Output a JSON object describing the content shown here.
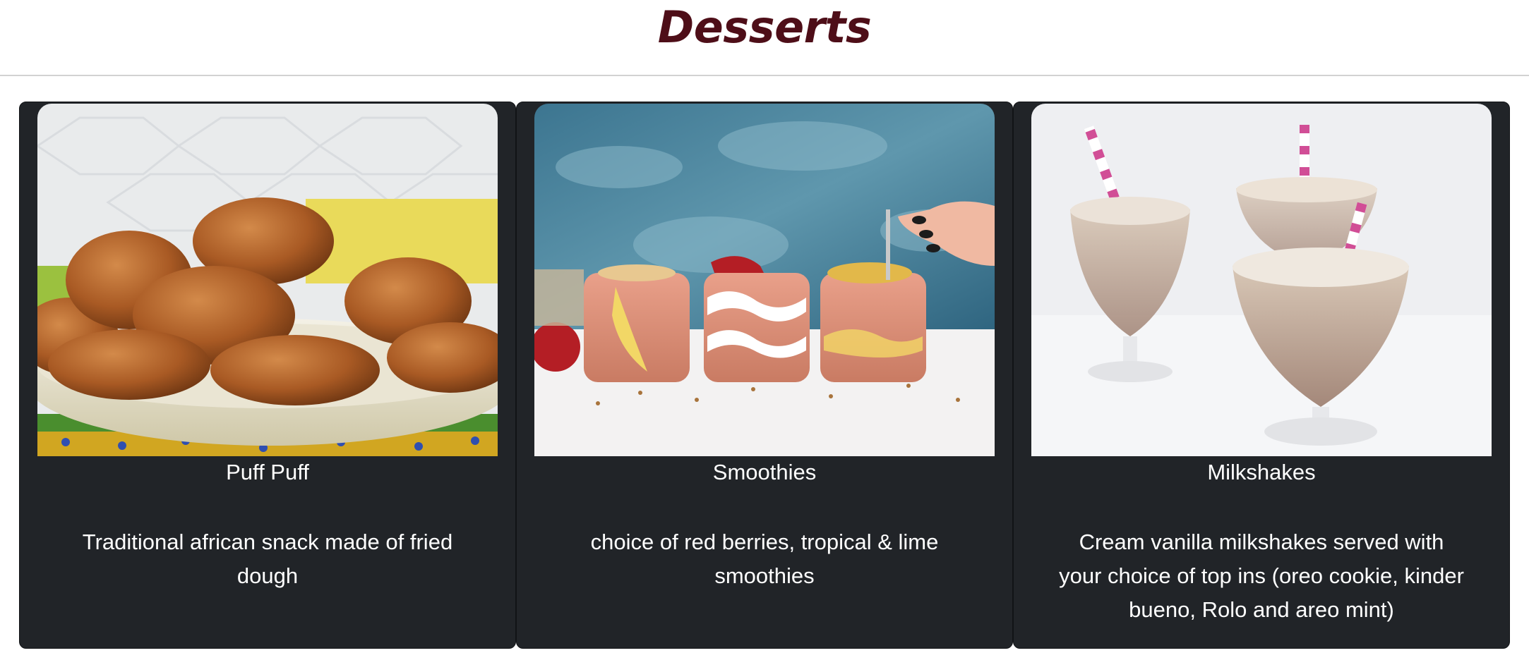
{
  "page": {
    "title": "Desserts"
  },
  "cards": [
    {
      "title": "Puff Puff",
      "description": "Traditional african snack made of fried dough",
      "image_icon": "puff-puff-photo"
    },
    {
      "title": "Smoothies",
      "description": "choice of red berries, tropical & lime smoothies",
      "image_icon": "smoothies-photo"
    },
    {
      "title": "Milkshakes",
      "description": "Cream vanilla milkshakes served with your choice of top ins (oreo cookie, kinder bueno, Rolo and areo mint)",
      "image_icon": "milkshakes-photo"
    }
  ],
  "colors": {
    "title": "#4e0e18",
    "card_bg": "#212428",
    "divider": "#d2d2d2"
  }
}
